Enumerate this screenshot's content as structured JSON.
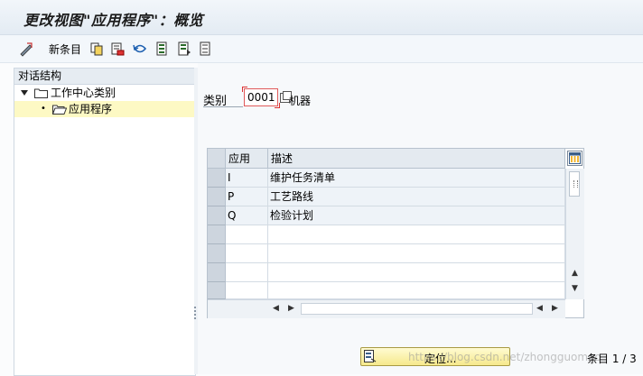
{
  "title": "更改视图\"应用程序\"：概览",
  "toolbar": {
    "new_entries": "新条目",
    "icons": [
      "edit-toggle-icon",
      "copy-icon",
      "delete-icon",
      "undo-icon",
      "select-all-icon",
      "select-block-icon",
      "deselect-all-icon"
    ]
  },
  "dialog_structure": {
    "header": "对话结构",
    "items": [
      {
        "label": "工作中心类别",
        "expanded": true,
        "selected": false
      },
      {
        "label": "应用程序",
        "expanded": false,
        "selected": true
      }
    ]
  },
  "category": {
    "label": "类别",
    "value": "0001",
    "description": "机器"
  },
  "table": {
    "columns": [
      "应用",
      "描述"
    ],
    "rows": [
      {
        "app": "I",
        "desc": "维护任务清单"
      },
      {
        "app": "P",
        "desc": "工艺路线"
      },
      {
        "app": "Q",
        "desc": "检验计划"
      }
    ],
    "empty_rows": 4
  },
  "footer": {
    "locate_button": "定位...",
    "entry_count": "条目 1 / 3",
    "watermark": "https://blog.csdn.net/zhongguomao"
  },
  "colors": {
    "selected_row": "#fdf9c4",
    "locate_button": "#f6e98c"
  }
}
